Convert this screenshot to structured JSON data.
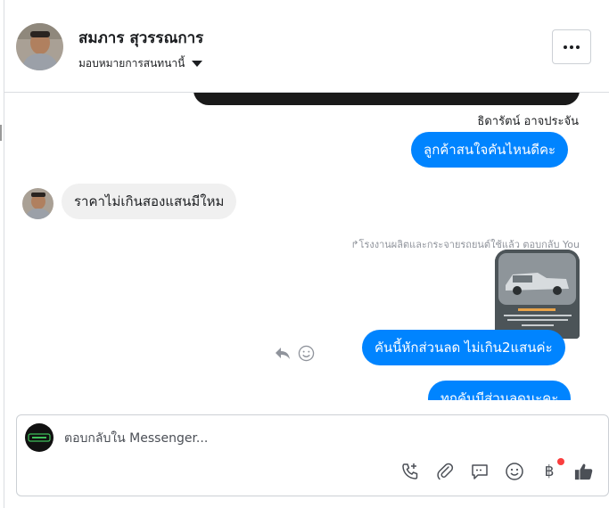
{
  "header": {
    "contact_name": "สมภาร สุวรรณการ",
    "assignment_label": "มอบหมายการสนทนานี้"
  },
  "thread": {
    "sender_name": "ธิดารัตน์ อาจประจัน",
    "messages": [
      {
        "direction": "out",
        "text": "ลูกค้าสนใจคันไหนดีคะ"
      },
      {
        "direction": "in",
        "text": "ราคาไม่เกินสองแสนมีใหม"
      },
      {
        "direction": "out",
        "text": "คันนี้หักส่วนลด ไม่เกิน2แสนค่ะ"
      },
      {
        "direction": "out",
        "text": "ทุกคันมีส่วนลดนะคะ"
      }
    ],
    "reply_note": "โรงงานผลิตและกระจายรถยนต์ใช้แล้ว ตอบกลับ You"
  },
  "composer": {
    "placeholder": "ตอบกลับใน Messenger..."
  },
  "colors": {
    "accent": "#0084ff",
    "incoming_bubble": "#f0f0f0",
    "notification_dot": "#fa3e3e"
  },
  "icons": [
    "phone-plus-icon",
    "paperclip-icon",
    "saved-replies-icon",
    "emoji-icon",
    "baht-payment-icon",
    "thumbs-up-icon",
    "reply-icon",
    "smiley-react-icon",
    "more-options-icon"
  ]
}
